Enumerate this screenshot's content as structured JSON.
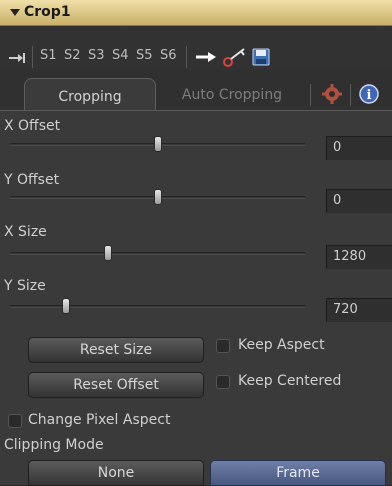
{
  "tool": {
    "name": "Crop1"
  },
  "toolbar": {
    "s_buttons": [
      "S1",
      "S2",
      "S3",
      "S4",
      "S5",
      "S6"
    ],
    "icons": [
      "pin-arrow-icon",
      "arrow-right-icon",
      "key-icon",
      "save-icon"
    ]
  },
  "tabs": [
    {
      "label": "Cropping",
      "active": true
    },
    {
      "label": "Auto Cropping",
      "active": false
    }
  ],
  "tab_icons": [
    "gear-icon",
    "info-icon"
  ],
  "controls": {
    "x_offset": {
      "label": "X Offset",
      "value": "0",
      "slider_fraction": 0.5
    },
    "y_offset": {
      "label": "Y Offset",
      "value": "0",
      "slider_fraction": 0.5
    },
    "x_size": {
      "label": "X Size",
      "value": "1280",
      "slider_fraction": 0.33
    },
    "y_size": {
      "label": "Y Size",
      "value": "720",
      "slider_fraction": 0.19
    }
  },
  "buttons": {
    "reset_size": "Reset Size",
    "reset_offset": "Reset Offset"
  },
  "checkboxes": {
    "keep_aspect": {
      "label": "Keep Aspect",
      "checked": false
    },
    "keep_centered": {
      "label": "Keep Centered",
      "checked": false
    },
    "change_pixel_aspect": {
      "label": "Change Pixel Aspect",
      "checked": false
    }
  },
  "clipping_mode": {
    "label": "Clipping Mode",
    "options": [
      "None",
      "Frame"
    ],
    "selected": "Frame"
  },
  "colors": {
    "title_bar": "#d8c27e",
    "panel": "#3a3a3a",
    "selected_option": "#5b6b95"
  }
}
